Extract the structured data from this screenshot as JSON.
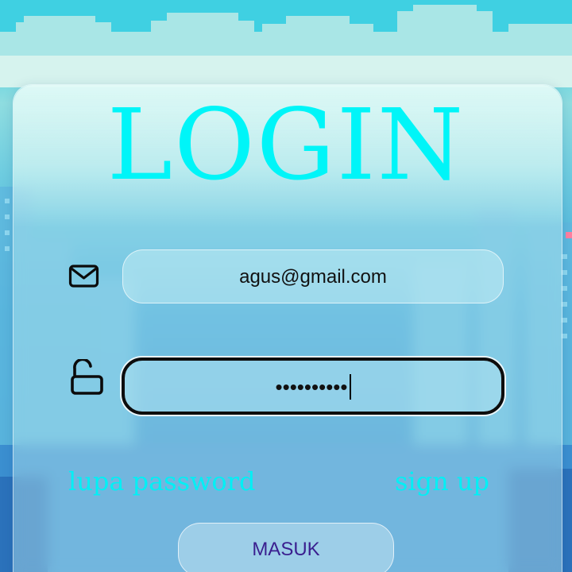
{
  "login": {
    "title": "LOGIN",
    "email_value": "agus@gmail.com",
    "password_mask": "••••••••••",
    "forgot_password_label": "lupa password",
    "signup_label": "sign up",
    "submit_label": "MASUK"
  },
  "icons": {
    "email": "mail-icon",
    "password": "unlock-icon"
  },
  "colors": {
    "title": "#00f5f8",
    "links": "#00f0f5",
    "button_text": "#3a1f8f",
    "focused_border": "#0d0d0d"
  }
}
